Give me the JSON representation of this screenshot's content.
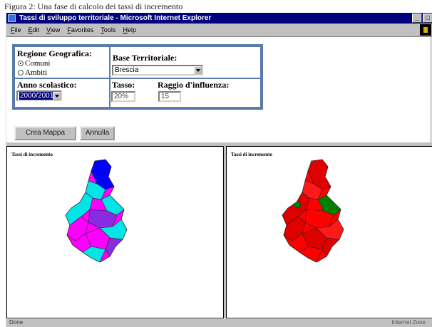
{
  "figure_caption": "Figura 2: Una fase di calcolo dei tassi di incremento",
  "window": {
    "title": "Tassi di sviluppo territoriale - Microsoft Internet Explorer",
    "minimize": "_",
    "maximize": "□"
  },
  "menu": [
    "File",
    "Edit",
    "View",
    "Favorites",
    "Tools",
    "Help"
  ],
  "form": {
    "regione_label": "Regione Geografica:",
    "radio_options": [
      {
        "label": "Comuni",
        "selected": true
      },
      {
        "label": "Ambiti",
        "selected": false
      }
    ],
    "base_label": "Base Territoriale:",
    "base_value": "Brescia",
    "anno_label": "Anno scolastico:",
    "anno_value": "2000/2001",
    "tasso_label": "Tasso:",
    "tasso_value": "20%",
    "raggio_label": "Raggio d'influenza:",
    "raggio_value": "15"
  },
  "buttons": {
    "crea": "Crea Mappa",
    "annulla": "Annulla"
  },
  "frames": {
    "left_title": "Tassi di incremento",
    "right_title": "Tassi di incremento"
  },
  "status": {
    "left": "Done",
    "right": "Internet Zone"
  },
  "colors": {
    "titlebar": "#00007f",
    "panel_border": "#5b7baa",
    "left_map_palette": [
      "#ff00ff",
      "#00e5e5",
      "#0000ff",
      "#8a2be2"
    ],
    "right_map_palette": [
      "#ff0000",
      "#cc0000",
      "#008000"
    ]
  }
}
